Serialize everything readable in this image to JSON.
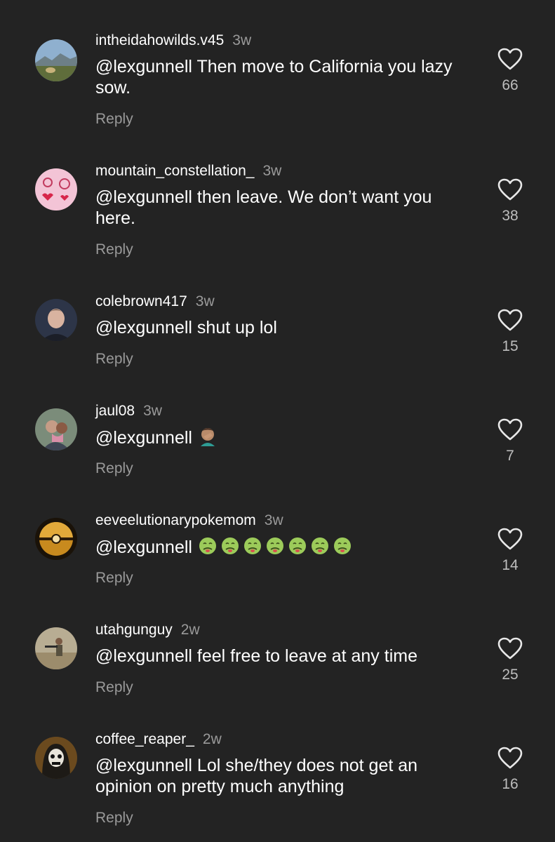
{
  "reply_label": "Reply",
  "comments": [
    {
      "username": "intheidahowilds.v45",
      "age": "3w",
      "mention": "@lexgunnell",
      "text": "Then move to California you lazy sow.",
      "likes": "66",
      "avatar": "landscape-avatar"
    },
    {
      "username": "mountain_constellation_",
      "age": "3w",
      "mention": "@lexgunnell",
      "text": "then leave. We don’t want you here.",
      "likes": "38",
      "avatar": "pink-drawing-avatar"
    },
    {
      "username": "colebrown417",
      "age": "3w",
      "mention": "@lexgunnell",
      "text": "shut up lol",
      "likes": "15",
      "avatar": "portrait-avatar"
    },
    {
      "username": "jaul08",
      "age": "3w",
      "mention": "@lexgunnell",
      "text": "",
      "likes": "7",
      "avatar": "couple-avatar",
      "emoji": [
        "facepalm-emoji"
      ]
    },
    {
      "username": "eeveelutionarypokemom",
      "age": "3w",
      "mention": "@lexgunnell",
      "text": "",
      "likes": "14",
      "avatar": "pokeball-avatar",
      "emoji": [
        "nauseated-face-emoji",
        "nauseated-face-emoji",
        "nauseated-face-emoji",
        "nauseated-face-emoji",
        "nauseated-face-emoji",
        "nauseated-face-emoji",
        "nauseated-face-emoji"
      ]
    },
    {
      "username": "utahgunguy",
      "age": "2w",
      "mention": "@lexgunnell",
      "text": "feel free to leave at any time",
      "likes": "25",
      "avatar": "outdoor-avatar"
    },
    {
      "username": "coffee_reaper_",
      "age": "2w",
      "mention": "@lexgunnell",
      "text": "Lol she/they does not get an opinion on pretty much anything",
      "likes": "16",
      "avatar": "skull-avatar"
    }
  ],
  "colors": {
    "background": "#232323",
    "text": "#ffffff",
    "muted": "#9a9a9a"
  }
}
